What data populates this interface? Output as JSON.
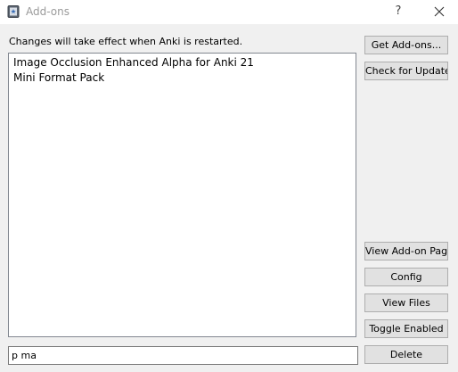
{
  "window": {
    "title": "Add-ons",
    "help_label": "?"
  },
  "notice": "Changes will take effect when Anki is restarted.",
  "addons": [
    {
      "label": "Image Occlusion Enhanced Alpha for Anki 21"
    },
    {
      "label": "Mini Format Pack"
    }
  ],
  "search": {
    "value": "p ma"
  },
  "buttons": {
    "get_addons": "Get Add-ons...",
    "check_updates": "Check for Updates",
    "view_page": "View Add-on Page",
    "config": "Config",
    "view_files": "View Files",
    "toggle_enabled": "Toggle Enabled",
    "delete": "Delete"
  },
  "colors": {
    "background": "#f0f0f0",
    "titlebar": "#ffffff",
    "button_face": "#e1e1e1",
    "button_border": "#adadad"
  },
  "icons": {
    "app": "anki-icon",
    "help": "help-icon",
    "close": "close-icon"
  }
}
